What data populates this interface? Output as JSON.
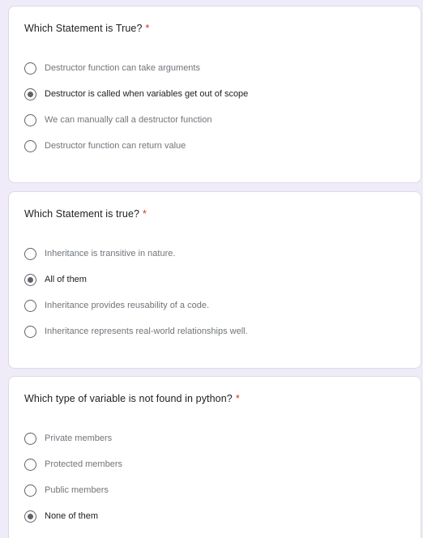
{
  "questions": [
    {
      "title": "Which Statement is True?",
      "required_mark": "*",
      "options": [
        {
          "label": "Destructor function can take arguments",
          "selected": false
        },
        {
          "label": "Destructor is called when variables get out of scope",
          "selected": true
        },
        {
          "label": "We can manually call a destructor function",
          "selected": false
        },
        {
          "label": "Destructor function can return value",
          "selected": false
        }
      ]
    },
    {
      "title": "Which Statement is true?",
      "required_mark": "*",
      "options": [
        {
          "label": "Inheritance is transitive in nature.",
          "selected": false
        },
        {
          "label": "All of them",
          "selected": true
        },
        {
          "label": "Inheritance provides reusability of a code.",
          "selected": false
        },
        {
          "label": "Inheritance represents real-world relationships well.",
          "selected": false
        }
      ]
    },
    {
      "title": "Which type of variable is not found in python?",
      "required_mark": "*",
      "options": [
        {
          "label": "Private members",
          "selected": false
        },
        {
          "label": "Protected members",
          "selected": false
        },
        {
          "label": "Public members",
          "selected": false
        },
        {
          "label": "None of them",
          "selected": true
        }
      ]
    }
  ],
  "colors": {
    "page_background": "#f0ebf8",
    "card_background": "#ffffff",
    "required_star": "#d93025",
    "radio": "#5f6368"
  },
  "icons": {
    "radio_unchecked": "radio-unchecked-icon",
    "radio_checked": "radio-checked-icon"
  }
}
